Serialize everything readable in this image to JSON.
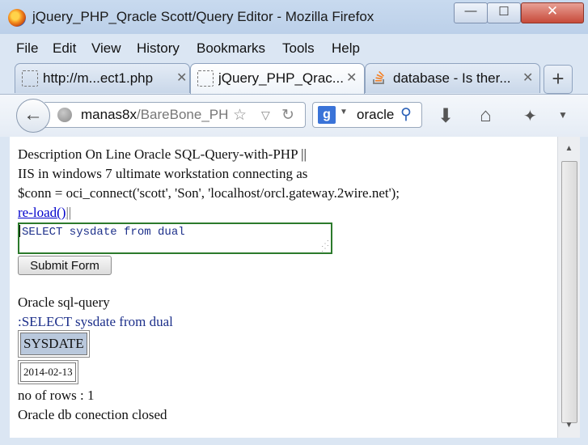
{
  "window": {
    "title": "jQuery_PHP_Qracle Scott/Query Editor - Mozilla Firefox",
    "buttons": {
      "minimize": "—",
      "maximize": "☐",
      "close": "✕"
    }
  },
  "menu": [
    "File",
    "Edit",
    "View",
    "History",
    "Bookmarks",
    "Tools",
    "Help"
  ],
  "tabs": [
    {
      "label": "http://m...ect1.php",
      "icon": "blank-page-icon",
      "active": false
    },
    {
      "label": "jQuery_PHP_Qrac...",
      "icon": "blank-page-icon",
      "active": true
    },
    {
      "label": "database - Is ther...",
      "icon": "stackoverflow-icon",
      "active": false
    }
  ],
  "tab_close_glyph": "✕",
  "new_tab_glyph": "+",
  "navbar": {
    "url_host": "manas8x",
    "url_rest": "/BareBone_PH",
    "search_engine_glyph": "g",
    "search_text": "oracle"
  },
  "page": {
    "line1": "Description On Line Oracle SQL-Query-with-PHP ||",
    "line2": "IIS in windows 7 ultimate workstation connecting as",
    "line3": "$conn = oci_connect('scott', 'Son', 'localhost/orcl.gateway.2wire.net');",
    "reload_link": "re-load()",
    "reload_sep": "||",
    "query_value": "SELECT sysdate from dual",
    "submit_label": "Submit Form",
    "result_heading": "Oracle sql-query",
    "result_echo": ":SELECT sysdate from dual",
    "column_header": "SYSDATE",
    "cell_value": "2014-02-13",
    "rows_text": "no of rows : 1",
    "closed_text": "Oracle db conection closed"
  },
  "colors": {
    "link": "#0000cc",
    "query_text": "#1c2f8a",
    "textarea_border": "#2c7a2c",
    "header_cell": "#b9c8dc"
  }
}
